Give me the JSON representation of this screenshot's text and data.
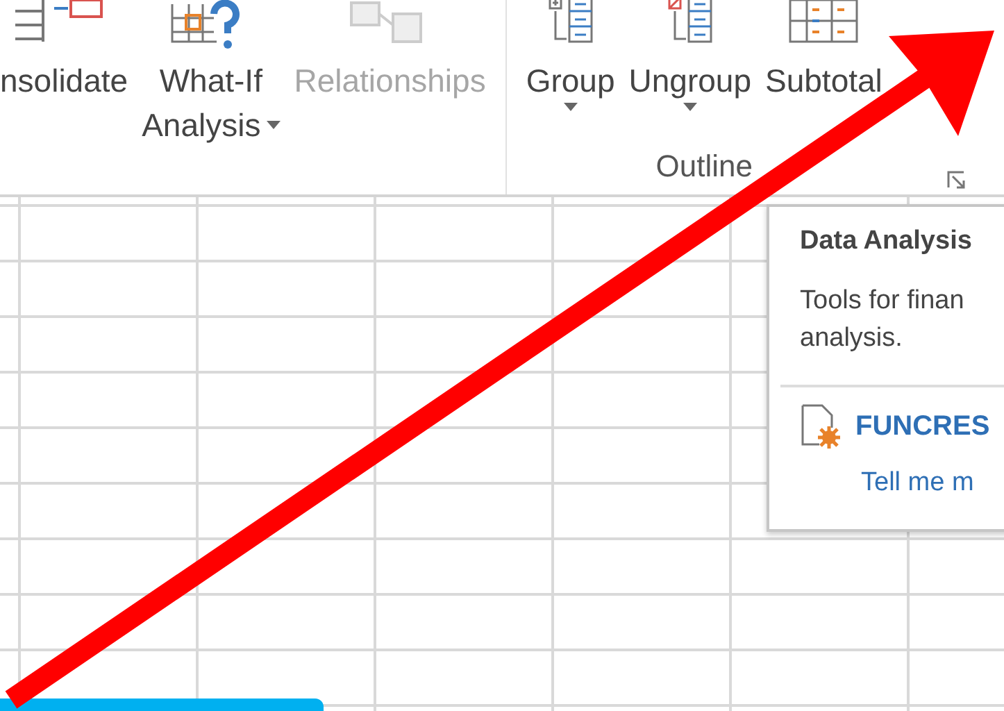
{
  "ribbon": {
    "groups": [
      {
        "buttons": [
          {
            "label": "nsolidate",
            "disabled": false,
            "dropdown": false
          },
          {
            "label": "What-If",
            "label_2": "Analysis",
            "disabled": false,
            "dropdown": true
          },
          {
            "label": "Relationships",
            "disabled": true,
            "dropdown": false
          }
        ]
      },
      {
        "label": "Outline",
        "launcher": true,
        "buttons": [
          {
            "label": "Group",
            "disabled": false,
            "dropdown": true
          },
          {
            "label": "Ungroup",
            "disabled": false,
            "dropdown": true
          },
          {
            "label": "Subtotal",
            "disabled": false,
            "dropdown": false
          }
        ]
      }
    ]
  },
  "tooltip": {
    "title": "Data Analysis",
    "lines": [
      "Tools for finan",
      "analysis."
    ],
    "addin": "FUNCRES",
    "link": "Tell me m"
  }
}
